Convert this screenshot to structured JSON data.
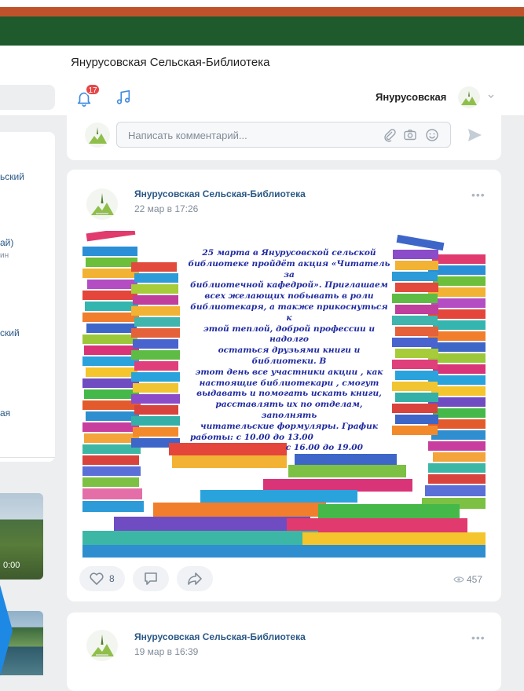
{
  "window": {
    "title": "Янурусовская Сельская-Библиотека"
  },
  "header": {
    "notifications_count": "17",
    "user_name": "Янурусовская"
  },
  "left_column": {
    "items": [
      {
        "label": "ьский",
        "sub": ""
      },
      {
        "label": "ай)",
        "sub": "ин"
      },
      {
        "label": "ский",
        "sub": ""
      },
      {
        "label": "ая",
        "sub": ""
      }
    ],
    "video_duration": "0:00"
  },
  "comment_box": {
    "placeholder": "Написать комментарий..."
  },
  "posts": [
    {
      "author": "Янурусовская Сельская-Библиотека",
      "date": "22 мар в 17:26",
      "poster_lines": [
        "25 марта в Янурусовской сельской",
        "библиотеке пройдёт акция «Читатель за",
        "библиотечной кафедрой». Приглашаем",
        "всех желающих побывать в роли",
        "библиотекаря, а также прикоснуться к",
        "этой теплой, доброй профессии и надолго",
        "остаться друзьями книги и библиотеки. В",
        "этот день все участники акции , как",
        "настоящие библиотекари , смогут",
        "выдавать и помогать искать книги,",
        "расставлять их по отделам, заполнять",
        "читательские формуляры. График",
        "работы: с 10.00 до 13.00"
      ],
      "poster_times_2": "с 16.00 до 19.00",
      "likes": "8",
      "views": "457"
    },
    {
      "author": "Янурусовская Сельская-Библиотека",
      "date": "19 мар в 16:39"
    }
  ],
  "colors": {
    "accent": "#2a5885",
    "brand_green": "#1e5a2c",
    "brand_red": "#c0522b",
    "badge_red": "#e64646"
  }
}
